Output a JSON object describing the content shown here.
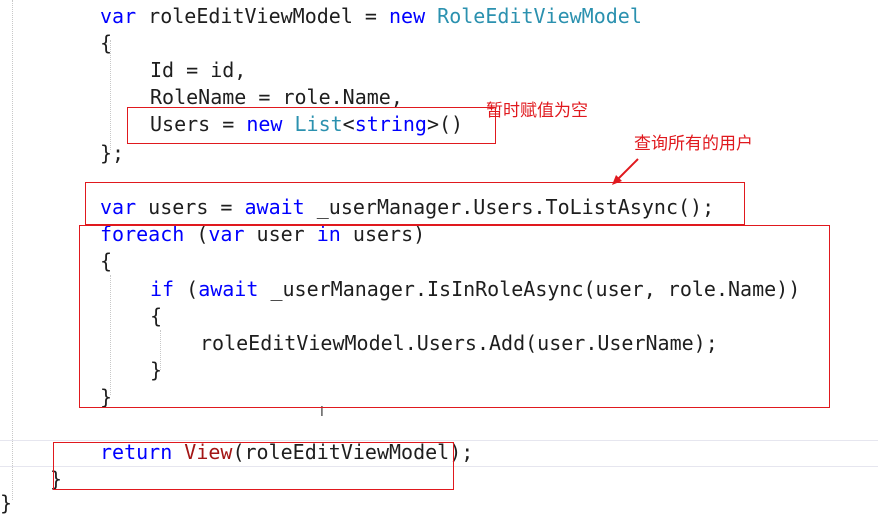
{
  "code": {
    "l1": {
      "kw": "var",
      "ident": " roleEditViewModel = ",
      "kw2": "new",
      "ty": " RoleEditViewModel"
    },
    "l2": "{",
    "l3": "Id = id,",
    "l4": "RoleName = role.Name,",
    "l5": {
      "a": "Users = ",
      "kw": "new",
      "ty": " List",
      "b": "<",
      "kw2": "string",
      "c": ">()"
    },
    "l6": "};",
    "l7": {
      "kw": "var",
      "a": " users = ",
      "kw2": "await",
      "b": " _userManager.Users.ToListAsync();"
    },
    "l8": {
      "kw": "foreach",
      "a": " (",
      "kw2": "var",
      "b": " user ",
      "kw3": "in",
      "c": " users)"
    },
    "l9": "{",
    "l10": {
      "kw": "if",
      "a": " (",
      "kw2": "await",
      "b": " _userManager.IsInRoleAsync(user, role.Name))"
    },
    "l11": "{",
    "l12": "roleEditViewModel.Users.Add(user.UserName);",
    "l13": "}",
    "l14": "}",
    "l15": {
      "kw": "return",
      "a": " ",
      "vw": "View",
      "b": "(roleEditViewModel);"
    },
    "l16": "}",
    "l17": "}"
  },
  "annotations": {
    "note1": "暂时赋值为空",
    "note2": "查询所有的用户"
  },
  "colors": {
    "keyword": "#0000ff",
    "type": "#2b91af",
    "annotation": "#e0191e"
  }
}
